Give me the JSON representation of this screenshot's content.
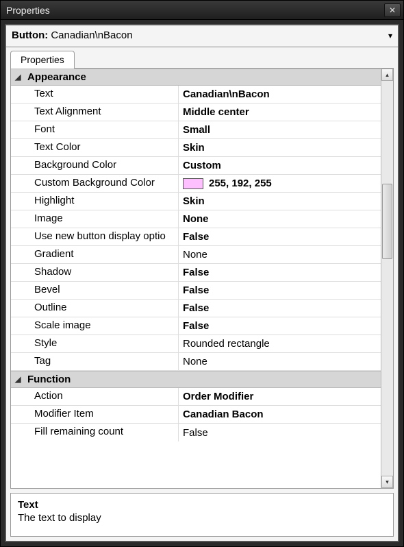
{
  "window": {
    "title": "Properties"
  },
  "object_selector": {
    "type_label": "Button:",
    "name": "Canadian\\nBacon"
  },
  "tabs": [
    {
      "label": "Properties"
    }
  ],
  "categories": [
    {
      "name": "Appearance",
      "expanded": true,
      "rows": [
        {
          "name": "Text",
          "value": "Canadian\\nBacon",
          "bold": true
        },
        {
          "name": "Text Alignment",
          "value": "Middle center",
          "bold": true
        },
        {
          "name": "Font",
          "value": "Small",
          "bold": true
        },
        {
          "name": "Text Color",
          "value": "Skin",
          "bold": true
        },
        {
          "name": "Background Color",
          "value": "Custom",
          "bold": true
        },
        {
          "name": "Custom Background Color",
          "value": "255, 192, 255",
          "bold": true,
          "swatch": "#ffc0ff"
        },
        {
          "name": "Highlight",
          "value": "Skin",
          "bold": true
        },
        {
          "name": "Image",
          "value": "None",
          "bold": true
        },
        {
          "name": "Use new button display optio",
          "value": "False",
          "bold": true
        },
        {
          "name": "Gradient",
          "value": "None",
          "bold": false
        },
        {
          "name": "Shadow",
          "value": "False",
          "bold": true
        },
        {
          "name": "Bevel",
          "value": "False",
          "bold": true
        },
        {
          "name": "Outline",
          "value": "False",
          "bold": true
        },
        {
          "name": "Scale image",
          "value": "False",
          "bold": true
        },
        {
          "name": "Style",
          "value": "Rounded rectangle",
          "bold": false
        },
        {
          "name": "Tag",
          "value": "None",
          "bold": false
        }
      ]
    },
    {
      "name": "Function",
      "expanded": true,
      "rows": [
        {
          "name": "Action",
          "value": "Order Modifier",
          "bold": true
        },
        {
          "name": "Modifier Item",
          "value": "Canadian Bacon",
          "bold": true
        },
        {
          "name": "Fill remaining count",
          "value": "False",
          "bold": false
        }
      ]
    }
  ],
  "help": {
    "title": "Text",
    "desc": "The text to display"
  }
}
